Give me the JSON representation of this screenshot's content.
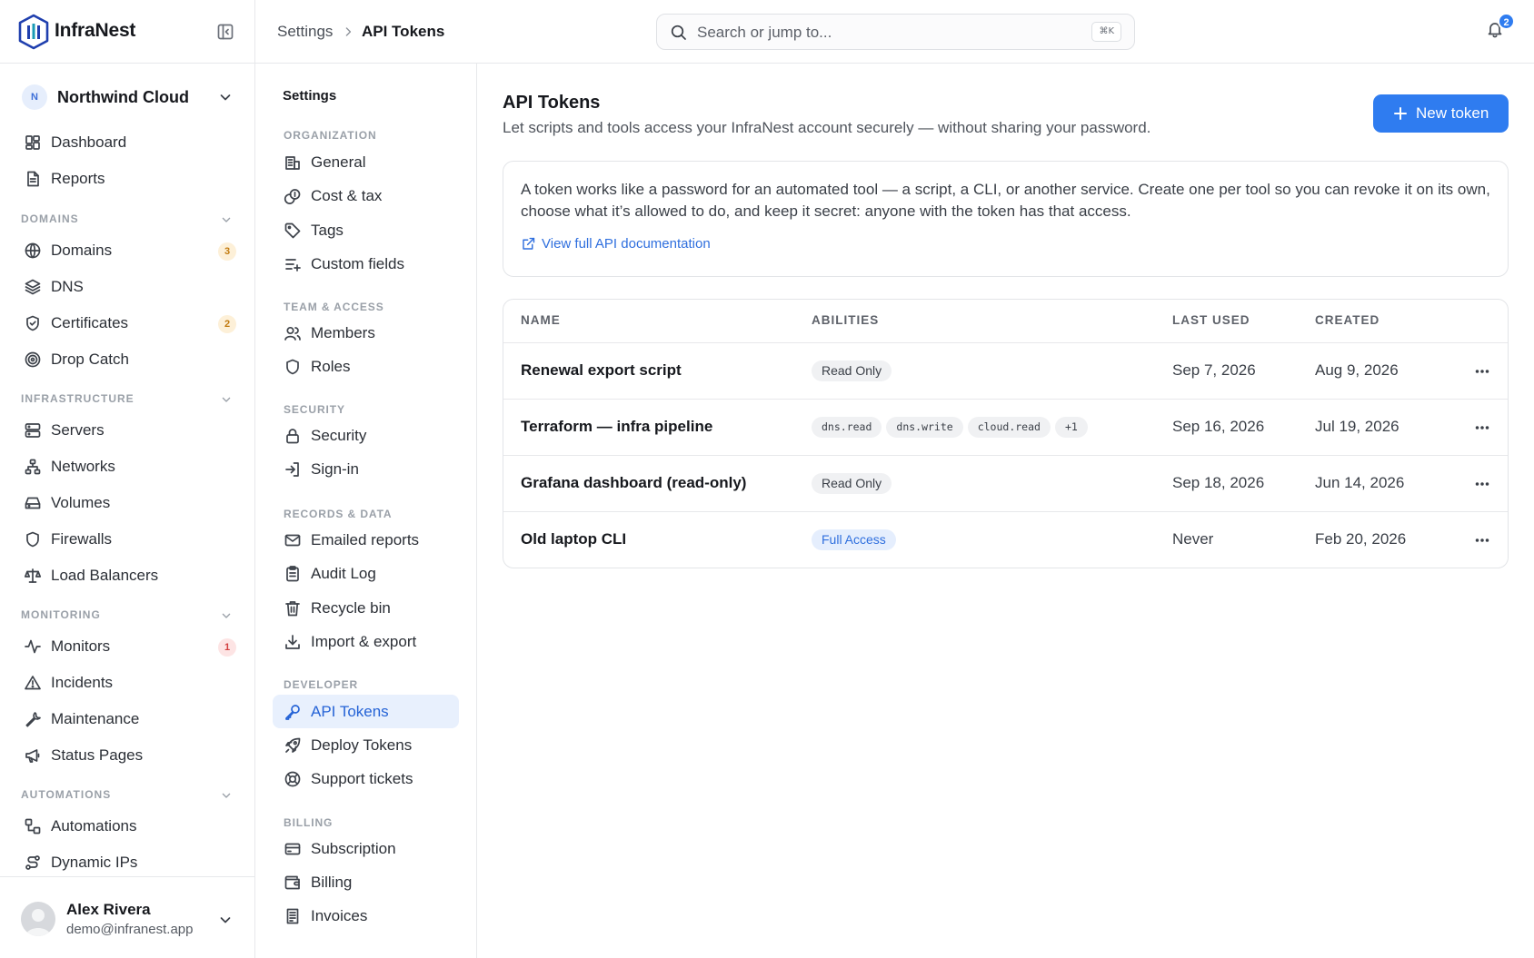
{
  "brand": {
    "name": "InfraNest"
  },
  "org": {
    "initial": "N",
    "name": "Northwind Cloud"
  },
  "sidebar": {
    "top": [
      {
        "label": "Dashboard",
        "icon": "dashboard-icon"
      },
      {
        "label": "Reports",
        "icon": "file-text-icon"
      }
    ],
    "sections": [
      {
        "title": "DOMAINS",
        "items": [
          {
            "label": "Domains",
            "icon": "globe-icon",
            "badge": "3",
            "badge_color": "#c27a0e"
          },
          {
            "label": "DNS",
            "icon": "layers-icon"
          },
          {
            "label": "Certificates",
            "icon": "shield-check-icon",
            "badge": "2",
            "badge_color": "#c27a0e"
          },
          {
            "label": "Drop Catch",
            "icon": "target-icon"
          }
        ]
      },
      {
        "title": "INFRASTRUCTURE",
        "items": [
          {
            "label": "Servers",
            "icon": "server-icon"
          },
          {
            "label": "Networks",
            "icon": "network-icon"
          },
          {
            "label": "Volumes",
            "icon": "hard-drive-icon"
          },
          {
            "label": "Firewalls",
            "icon": "shield-icon"
          },
          {
            "label": "Load Balancers",
            "icon": "scale-icon"
          }
        ]
      },
      {
        "title": "MONITORING",
        "items": [
          {
            "label": "Monitors",
            "icon": "activity-icon",
            "badge": "1",
            "badge_color": "#d23f3f"
          },
          {
            "label": "Incidents",
            "icon": "alert-triangle-icon"
          },
          {
            "label": "Maintenance",
            "icon": "wrench-icon"
          },
          {
            "label": "Status Pages",
            "icon": "megaphone-icon"
          }
        ]
      },
      {
        "title": "AUTOMATIONS",
        "items": [
          {
            "label": "Automations",
            "icon": "workflow-icon"
          },
          {
            "label": "Dynamic IPs",
            "icon": "route-icon"
          }
        ]
      }
    ]
  },
  "user": {
    "name": "Alex Rivera",
    "email": "demo@infranest.app"
  },
  "topbar": {
    "breadcrumb_root": "Settings",
    "breadcrumb_current": "API Tokens",
    "search_placeholder": "Search or jump to...",
    "search_shortcut": "⌘K",
    "notifications_count": "2"
  },
  "subnav": {
    "title": "Settings",
    "sections": [
      {
        "title": "ORGANIZATION",
        "items": [
          "General",
          "Cost & tax",
          "Tags",
          "Custom fields"
        ]
      },
      {
        "title": "TEAM & ACCESS",
        "items": [
          "Members",
          "Roles"
        ]
      },
      {
        "title": "SECURITY",
        "items": [
          "Security",
          "Sign-in"
        ]
      },
      {
        "title": "RECORDS & DATA",
        "items": [
          "Emailed reports",
          "Audit Log",
          "Recycle bin",
          "Import & export"
        ]
      },
      {
        "title": "DEVELOPER",
        "items": [
          "API Tokens",
          "Deploy Tokens",
          "Support tickets"
        ]
      },
      {
        "title": "BILLING",
        "items": [
          "Subscription",
          "Billing",
          "Invoices"
        ]
      }
    ],
    "active": "API Tokens"
  },
  "main": {
    "title": "API Tokens",
    "subtitle": "Let scripts and tools access your InfraNest account securely — without sharing your password.",
    "new_button": "New token",
    "info_text": "A token works like a password for an automated tool — a script, a CLI, or another service. Create one per tool so you can revoke it on its own, choose what it’s allowed to do, and keep it secret: anyone with the token has that access.",
    "info_link": "View full API documentation",
    "columns": {
      "name": "NAME",
      "abilities": "ABILITIES",
      "last_used": "LAST USED",
      "created": "CREATED"
    },
    "tokens": [
      {
        "name": "Renewal export script",
        "abilities": [
          {
            "text": "Read Only",
            "style": "plain"
          }
        ],
        "last_used": "Sep 7, 2026",
        "created": "Aug 9, 2026"
      },
      {
        "name": "Terraform — infra pipeline",
        "abilities": [
          {
            "text": "dns.read",
            "style": "mono"
          },
          {
            "text": "dns.write",
            "style": "mono"
          },
          {
            "text": "cloud.read",
            "style": "mono"
          },
          {
            "text": "+1",
            "style": "mono"
          }
        ],
        "last_used": "Sep 16, 2026",
        "created": "Jul 19, 2026"
      },
      {
        "name": "Grafana dashboard (read-only)",
        "abilities": [
          {
            "text": "Read Only",
            "style": "plain"
          }
        ],
        "last_used": "Sep 18, 2026",
        "created": "Jun 14, 2026"
      },
      {
        "name": "Old laptop CLI",
        "abilities": [
          {
            "text": "Full Access",
            "style": "blue"
          }
        ],
        "last_used": "Never",
        "created": "Feb 20, 2026"
      }
    ]
  },
  "colors": {
    "accent": "#2f7cf0",
    "active_bg": "#e8f0fd",
    "badge_amber": "#c27a0e",
    "badge_red": "#d23f3f"
  }
}
